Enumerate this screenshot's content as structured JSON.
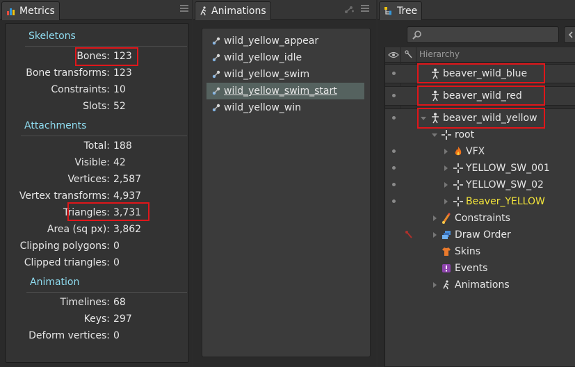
{
  "metrics": {
    "tab_label": "Metrics",
    "sections": {
      "skeletons": "Skeletons",
      "attachments": "Attachments",
      "animation": "Animation"
    },
    "rows": [
      {
        "label": "Bones:",
        "value": "123"
      },
      {
        "label": "Bone transforms:",
        "value": "123"
      },
      {
        "label": "Constraints:",
        "value": "10"
      },
      {
        "label": "Slots:",
        "value": "52"
      },
      {
        "label": "Total:",
        "value": "188"
      },
      {
        "label": "Visible:",
        "value": "42"
      },
      {
        "label": "Vertices:",
        "value": "2,587"
      },
      {
        "label": "Vertex transforms:",
        "value": "4,937"
      },
      {
        "label": "Triangles:",
        "value": "3,731"
      },
      {
        "label": "Area (sq px):",
        "value": "3,862"
      },
      {
        "label": "Clipping polygons:",
        "value": "0"
      },
      {
        "label": "Clipped triangles:",
        "value": "0"
      },
      {
        "label": "Timelines:",
        "value": "68"
      },
      {
        "label": "Keys:",
        "value": "297"
      },
      {
        "label": "Deform vertices:",
        "value": "0"
      }
    ]
  },
  "animations": {
    "tab_label": "Animations",
    "items": [
      "wild_yellow_appear",
      "wild_yellow_idle",
      "wild_yellow_swim",
      "wild_yellow_swim_start",
      "wild_yellow_win"
    ],
    "selected_index": 3
  },
  "tree": {
    "tab_label": "Tree",
    "search": {
      "value": "",
      "placeholder": ""
    },
    "header": "Hierarchy",
    "nodes": {
      "skel1": "beaver_wild_blue",
      "skel2": "beaver_wild_red",
      "skel3": "beaver_wild_yellow",
      "root": "root",
      "vfx": "VFX",
      "sw1": "YELLOW_SW_001",
      "sw2": "YELLOW_SW_02",
      "beaver": "Beaver_YELLOW",
      "constraints": "Constraints",
      "draw_order": "Draw Order",
      "skins": "Skins",
      "events": "Events",
      "animations": "Animations"
    }
  },
  "colors": {
    "section_title": "#8fdcf0",
    "highlight_box": "#e0161a",
    "selected_item": "#55625f",
    "yellow_text": "#f5e63a"
  }
}
